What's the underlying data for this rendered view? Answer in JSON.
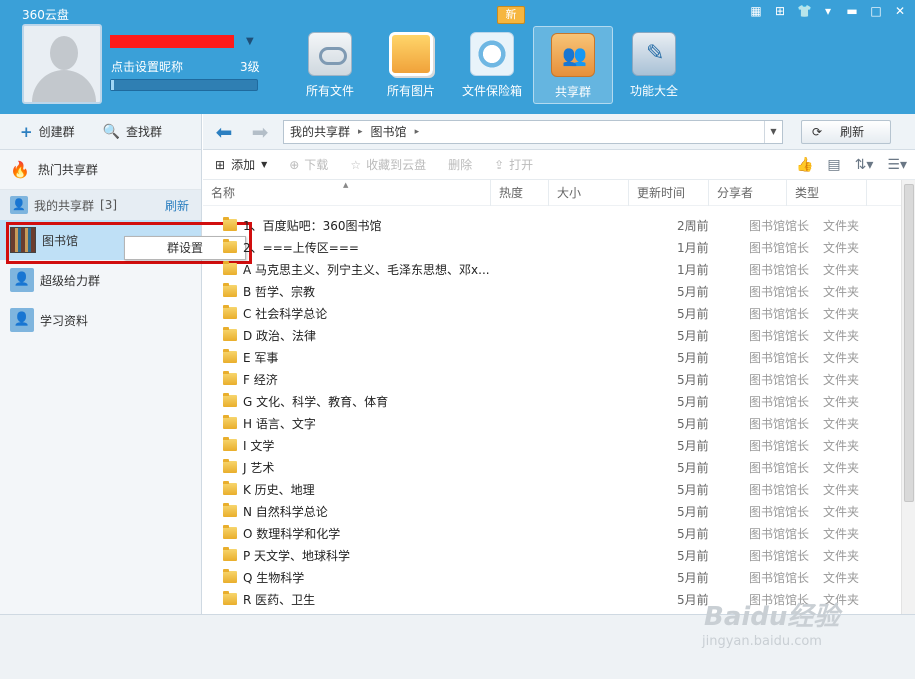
{
  "app": {
    "title": "360云盘"
  },
  "window_controls": {
    "calendar": "▦",
    "skin": "⊞",
    "shirt": "👕",
    "menu": "▾",
    "minimize": "▬",
    "maximize": "□",
    "close": "✕"
  },
  "user": {
    "set_nickname": "点击设置昵称",
    "level": "3级",
    "level_progress": 0.02
  },
  "new_badge": "新",
  "nav": [
    {
      "label": "所有文件",
      "icon": "cloud-disk-icon"
    },
    {
      "label": "所有图片",
      "icon": "photos-icon"
    },
    {
      "label": "文件保险箱",
      "icon": "safe-icon"
    },
    {
      "label": "共享群",
      "icon": "share-group-icon",
      "active": true
    },
    {
      "label": "功能大全",
      "icon": "toolbox-icon"
    }
  ],
  "sidebar": {
    "create_group": "创建群",
    "find_group": "查找群",
    "hot_groups": "热门共享群",
    "my_groups": "我的共享群",
    "my_groups_count": "[3]",
    "refresh": "刷新",
    "groups": [
      {
        "label": "图书馆"
      },
      {
        "label": "超级给力群"
      },
      {
        "label": "学习资料"
      }
    ],
    "context_menu": "群设置"
  },
  "address": {
    "crumbs": [
      "我的共享群",
      "图书馆"
    ],
    "refresh": "刷新"
  },
  "toolbar": {
    "add": "添加",
    "download": "下载",
    "save_to_cloud": "收藏到云盘",
    "delete": "删除",
    "open": "打开"
  },
  "columns": {
    "name": "名称",
    "hot": "热度",
    "size": "大小",
    "time": "更新时间",
    "owner": "分享者",
    "type": "类型"
  },
  "files": [
    {
      "name": "1、百度贴吧：360图书馆",
      "time": "2周前",
      "owner": "图书馆馆长",
      "type": "文件夹"
    },
    {
      "name": "2、===上传区===",
      "time": "1月前",
      "owner": "图书馆馆长",
      "type": "文件夹"
    },
    {
      "name": "A 马克思主义、列宁主义、毛泽东思想、邓x...",
      "time": "1月前",
      "owner": "图书馆馆长",
      "type": "文件夹"
    },
    {
      "name": "B 哲学、宗教",
      "time": "5月前",
      "owner": "图书馆馆长",
      "type": "文件夹"
    },
    {
      "name": "C 社会科学总论",
      "time": "5月前",
      "owner": "图书馆馆长",
      "type": "文件夹"
    },
    {
      "name": "D 政治、法律",
      "time": "5月前",
      "owner": "图书馆馆长",
      "type": "文件夹"
    },
    {
      "name": "E 军事",
      "time": "5月前",
      "owner": "图书馆馆长",
      "type": "文件夹"
    },
    {
      "name": "F 经济",
      "time": "5月前",
      "owner": "图书馆馆长",
      "type": "文件夹"
    },
    {
      "name": "G 文化、科学、教育、体育",
      "time": "5月前",
      "owner": "图书馆馆长",
      "type": "文件夹"
    },
    {
      "name": "H 语言、文字",
      "time": "5月前",
      "owner": "图书馆馆长",
      "type": "文件夹"
    },
    {
      "name": "I 文学",
      "time": "5月前",
      "owner": "图书馆馆长",
      "type": "文件夹"
    },
    {
      "name": "J 艺术",
      "time": "5月前",
      "owner": "图书馆馆长",
      "type": "文件夹"
    },
    {
      "name": "K 历史、地理",
      "time": "5月前",
      "owner": "图书馆馆长",
      "type": "文件夹"
    },
    {
      "name": "N 自然科学总论",
      "time": "5月前",
      "owner": "图书馆馆长",
      "type": "文件夹"
    },
    {
      "name": "O 数理科学和化学",
      "time": "5月前",
      "owner": "图书馆馆长",
      "type": "文件夹"
    },
    {
      "name": "P 天文学、地球科学",
      "time": "5月前",
      "owner": "图书馆馆长",
      "type": "文件夹"
    },
    {
      "name": "Q 生物科学",
      "time": "5月前",
      "owner": "图书馆馆长",
      "type": "文件夹"
    },
    {
      "name": "R 医药、卫生",
      "time": "5月前",
      "owner": "图书馆馆长",
      "type": "文件夹"
    }
  ],
  "watermark": {
    "brand": "Baidu经验",
    "url": "jingyan.baidu.com"
  }
}
